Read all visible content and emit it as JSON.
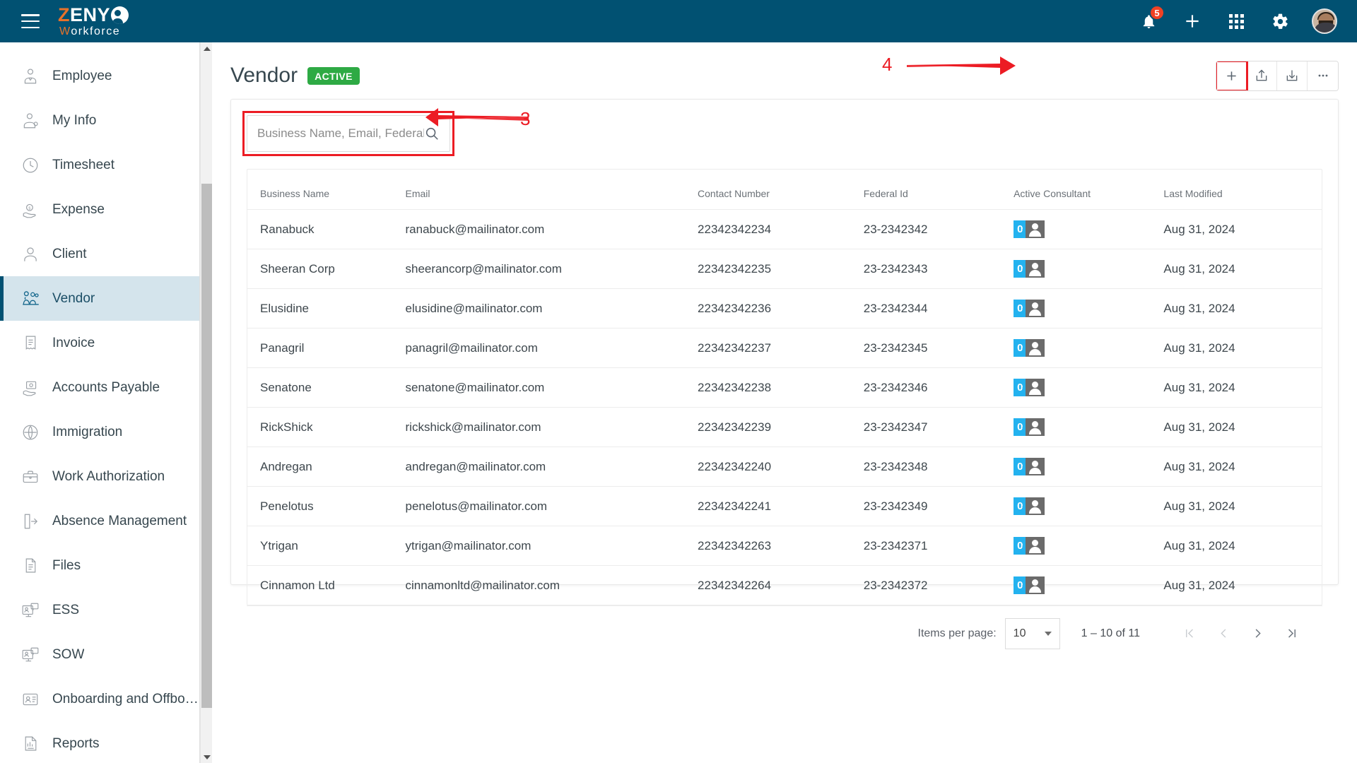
{
  "header": {
    "menu_icon": "hamburger-icon",
    "brand": {
      "part1": "Z",
      "part2": "ENY",
      "logo_icon": "globe-person-icon",
      "subtitle_w": "W",
      "subtitle_rest": "orkforce"
    },
    "notifications": {
      "icon": "bell-icon",
      "count": "5"
    },
    "add_icon": "plus-icon",
    "apps_icon": "grid-apps-icon",
    "settings_icon": "gear-icon",
    "avatar_icon": "user-avatar"
  },
  "sidebar": {
    "items": [
      {
        "label": "Employee",
        "icon": "employee-icon",
        "active": false
      },
      {
        "label": "My Info",
        "icon": "my-info-icon",
        "active": false
      },
      {
        "label": "Timesheet",
        "icon": "clock-icon",
        "active": false
      },
      {
        "label": "Expense",
        "icon": "expense-hand-icon",
        "active": false
      },
      {
        "label": "Client",
        "icon": "person-icon",
        "active": false
      },
      {
        "label": "Vendor",
        "icon": "vendor-group-icon",
        "active": true
      },
      {
        "label": "Invoice",
        "icon": "invoice-icon",
        "active": false
      },
      {
        "label": "Accounts Payable",
        "icon": "accounts-payable-icon",
        "active": false
      },
      {
        "label": "Immigration",
        "icon": "airplane-globe-icon",
        "active": false
      },
      {
        "label": "Work Authorization",
        "icon": "briefcase-icon",
        "active": false
      },
      {
        "label": "Absence Management",
        "icon": "door-exit-icon",
        "active": false
      },
      {
        "label": "Files",
        "icon": "documents-icon",
        "active": false
      },
      {
        "label": "ESS",
        "icon": "monitor-chat-icon",
        "active": false
      },
      {
        "label": "SOW",
        "icon": "monitor-chat-icon",
        "active": false
      },
      {
        "label": "Onboarding and Offboa...",
        "icon": "id-card-icon",
        "active": false
      },
      {
        "label": "Reports",
        "icon": "report-chart-icon",
        "active": false
      }
    ]
  },
  "page": {
    "title": "Vendor",
    "status": "ACTIVE",
    "actions": [
      {
        "name": "add-button",
        "icon": "plus-icon",
        "highlighted": true
      },
      {
        "name": "upload-button",
        "icon": "upload-icon",
        "highlighted": false
      },
      {
        "name": "download-button",
        "icon": "download-icon",
        "highlighted": false
      },
      {
        "name": "more-options-button",
        "icon": "ellipsis-icon",
        "highlighted": false
      }
    ]
  },
  "search": {
    "placeholder": "Business Name, Email, Federal Id",
    "value": "",
    "icon": "search-icon"
  },
  "table": {
    "columns": [
      "Business Name",
      "Email",
      "Contact Number",
      "Federal Id",
      "Active Consultant",
      "Last Modified"
    ],
    "rows": [
      {
        "business_name": "Ranabuck",
        "email": "ranabuck@mailinator.com",
        "contact_number": "22342342234",
        "federal_id": "23-2342342",
        "active_consultant": "0",
        "last_modified": "Aug 31, 2024"
      },
      {
        "business_name": "Sheeran Corp",
        "email": "sheerancorp@mailinator.com",
        "contact_number": "22342342235",
        "federal_id": "23-2342343",
        "active_consultant": "0",
        "last_modified": "Aug 31, 2024"
      },
      {
        "business_name": "Elusidine",
        "email": "elusidine@mailinator.com",
        "contact_number": "22342342236",
        "federal_id": "23-2342344",
        "active_consultant": "0",
        "last_modified": "Aug 31, 2024"
      },
      {
        "business_name": "Panagril",
        "email": "panagril@mailinator.com",
        "contact_number": "22342342237",
        "federal_id": "23-2342345",
        "active_consultant": "0",
        "last_modified": "Aug 31, 2024"
      },
      {
        "business_name": "Senatone",
        "email": "senatone@mailinator.com",
        "contact_number": "22342342238",
        "federal_id": "23-2342346",
        "active_consultant": "0",
        "last_modified": "Aug 31, 2024"
      },
      {
        "business_name": "RickShick",
        "email": "rickshick@mailinator.com",
        "contact_number": "22342342239",
        "federal_id": "23-2342347",
        "active_consultant": "0",
        "last_modified": "Aug 31, 2024"
      },
      {
        "business_name": "Andregan",
        "email": "andregan@mailinator.com",
        "contact_number": "22342342240",
        "federal_id": "23-2342348",
        "active_consultant": "0",
        "last_modified": "Aug 31, 2024"
      },
      {
        "business_name": "Penelotus",
        "email": "penelotus@mailinator.com",
        "contact_number": "22342342241",
        "federal_id": "23-2342349",
        "active_consultant": "0",
        "last_modified": "Aug 31, 2024"
      },
      {
        "business_name": "Ytrigan",
        "email": "ytrigan@mailinator.com",
        "contact_number": "22342342263",
        "federal_id": "23-2342371",
        "active_consultant": "0",
        "last_modified": "Aug 31, 2024"
      },
      {
        "business_name": "Cinnamon Ltd",
        "email": "cinnamonltd@mailinator.com",
        "contact_number": "22342342264",
        "federal_id": "23-2342372",
        "active_consultant": "0",
        "last_modified": "Aug 31, 2024"
      }
    ]
  },
  "paginator": {
    "items_per_page_label": "Items per page:",
    "items_per_page_value": "10",
    "range_label": "1 – 10 of 11",
    "first_icon": "first-page-icon",
    "prev_icon": "previous-page-icon",
    "next_icon": "next-page-icon",
    "last_icon": "last-page-icon"
  },
  "annotations": [
    {
      "label": "3",
      "target": "search-input"
    },
    {
      "label": "4",
      "target": "add-button"
    }
  ],
  "colors": {
    "header_bg": "#015172",
    "accent_orange": "#e8722a",
    "active_green": "#2eaa44",
    "annotation_red": "#ec1c24",
    "badge_cyan": "#23b2ef",
    "sidebar_active_bg": "#d4e4ec"
  }
}
